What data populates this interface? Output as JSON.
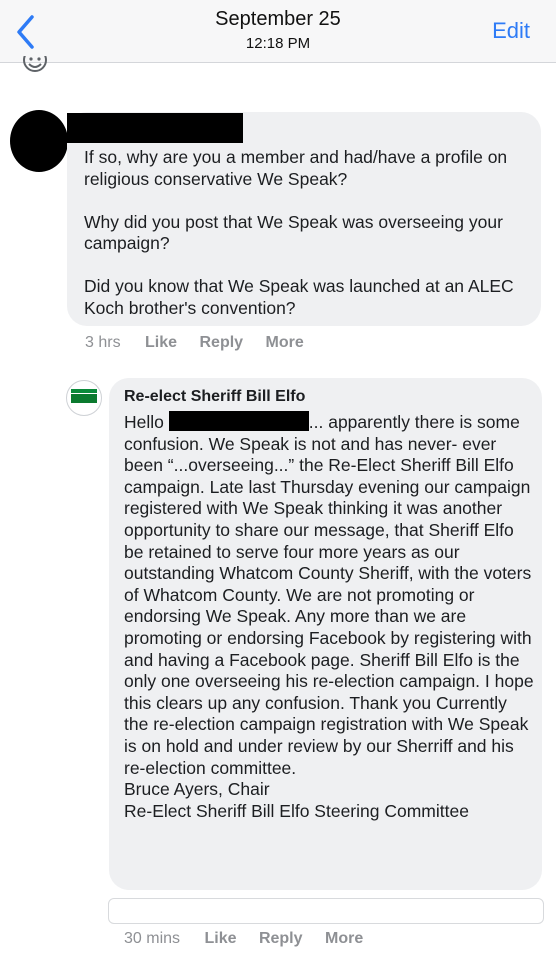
{
  "header": {
    "date": "September 25",
    "time": "12:18 PM",
    "edit_label": "Edit"
  },
  "comment1": {
    "paragraphs": [
      "If so, why are you a member and had/have a profile on religious conservative We Speak?",
      "Why did you post that We Speak was overseeing your campaign?",
      "Did you know that We Speak was launched at an ALEC Koch brother's convention?"
    ],
    "time": "3 hrs",
    "like": "Like",
    "reply": "Reply",
    "more": "More"
  },
  "comment2": {
    "author": "Re-elect Sheriff Bill Elfo",
    "greeting": "Hello",
    "body": "... apparently there is some confusion. We Speak is not and has never- ever been “...overseeing...” the Re-Elect Sheriff Bill Elfo campaign. Late last Thursday evening our campaign registered with We Speak thinking it was another opportunity to share our message, that Sheriff Elfo be retained to serve four more years as our outstanding Whatcom County Sheriff, with the voters of Whatcom County. We are not promoting or endorsing We Speak. Any more than we are promoting or endorsing Facebook by registering with and having a Facebook page. Sheriff Bill Elfo is the only one overseeing his re-election campaign. I hope this clears up any confusion. Thank you Currently the re-election campaign registration with We Speak is on hold and under review by our Sherriff and his re-election committee.\nBruce Ayers, Chair\nRe-Elect Sheriff Bill Elfo Steering Committee",
    "time": "30 mins",
    "like": "Like",
    "reply": "Reply",
    "more": "More"
  },
  "colors": {
    "accent": "#2e7bf6",
    "bubble": "#eff0f2",
    "meta": "#8e9094"
  },
  "icons": [
    "back-chevron-icon",
    "emoji-icon"
  ]
}
